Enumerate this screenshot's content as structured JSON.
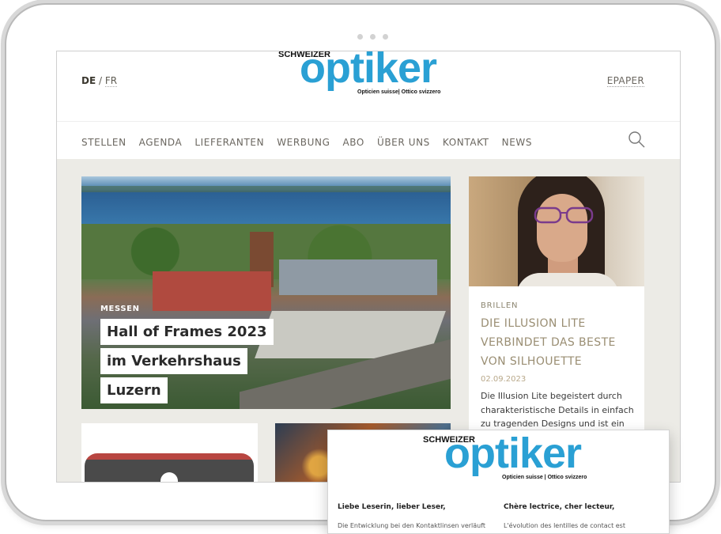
{
  "site": {
    "lang_active": "DE",
    "lang_sep": " / ",
    "lang_other": "FR",
    "epaper": "EPAPER",
    "logo": {
      "kicker": "SCHWEIZER",
      "word": "optiker",
      "sub": "Opticien suisse| Ottico svizzero"
    },
    "nav": [
      "STELLEN",
      "AGENDA",
      "LIEFERANTEN",
      "WERBUNG",
      "ABO",
      "ÜBER UNS",
      "KONTAKT",
      "NEWS"
    ],
    "search_icon": "search-icon"
  },
  "hero": {
    "category": "MESSEN",
    "title": "Hall of Frames 2023 im Verkehrshaus Luzern"
  },
  "card": {
    "category": "BRILLEN",
    "title": "DIE ILLUSION LITE VERBINDET DAS BESTE VON SILHOUETTE",
    "date": "02.09.2023",
    "excerpt": "Die Illusion Lite begeistert durch charakteristische Details in einfach zu tragenden Designs und ist ein"
  },
  "popup": {
    "logo": {
      "kicker": "SCHWEIZER",
      "word": "optiker",
      "sub": "Opticien suisse | Ottico svizzero"
    },
    "greeting_de": "Liebe Leserin, lieber Leser,",
    "greeting_fr": "Chère lectrice, cher lecteur,",
    "snippet_de": "Die Entwicklung bei den Kontaktlinsen verläuft",
    "snippet_fr": "L'évolution des lentilles de contact est"
  },
  "colors": {
    "logo_blue": "#2aa0d4",
    "accent_tan": "#9a8e73",
    "page_bg": "#ecebe6"
  }
}
